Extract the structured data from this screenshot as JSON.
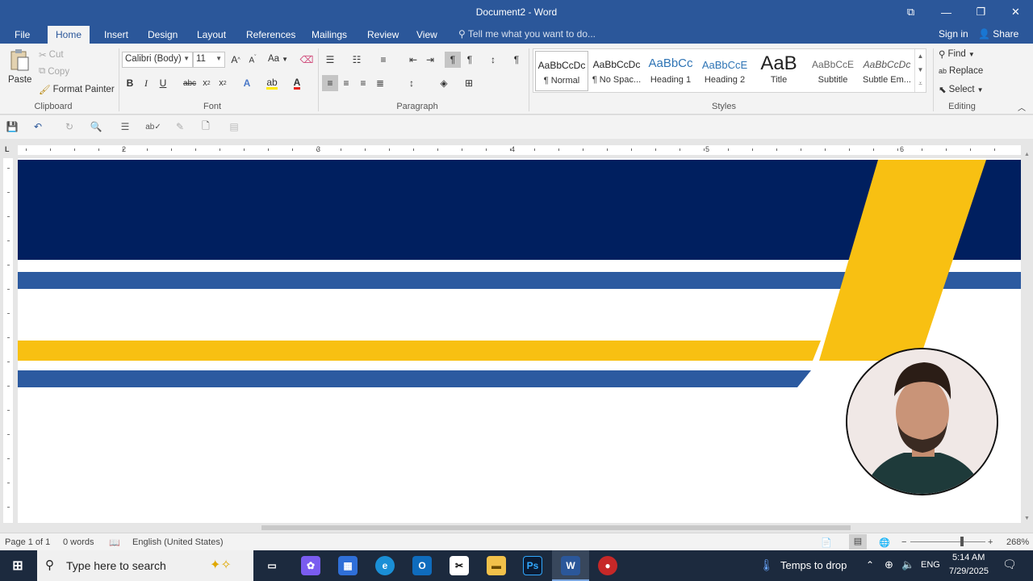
{
  "window": {
    "title": "Document2 - Word",
    "controls": [
      "⧉",
      "—",
      "❐",
      "✕"
    ]
  },
  "tabs": {
    "items": [
      "File",
      "Home",
      "Insert",
      "Design",
      "Layout",
      "References",
      "Mailings",
      "Review",
      "View"
    ],
    "active": "Home",
    "tellme": "Tell me what you want to do...",
    "signin": "Sign in",
    "share": "Share"
  },
  "ribbon": {
    "clipboard": {
      "label": "Clipboard",
      "paste": "Paste",
      "cut": "Cut",
      "copy": "Copy",
      "format_painter": "Format Painter"
    },
    "font": {
      "label": "Font",
      "name": "Calibri (Body)",
      "size": "11",
      "case_btn": "Aa"
    },
    "paragraph": {
      "label": "Paragraph"
    },
    "styles": {
      "label": "Styles",
      "items": [
        {
          "preview": "AaBbCcDc",
          "name": "¶ Normal"
        },
        {
          "preview": "AaBbCcDc",
          "name": "¶ No Spac..."
        },
        {
          "preview": "AaBbCc",
          "name": "Heading 1"
        },
        {
          "preview": "AaBbCcE",
          "name": "Heading 2"
        },
        {
          "preview": "AaB",
          "name": "Title"
        },
        {
          "preview": "AaBbCcE",
          "name": "Subtitle"
        },
        {
          "preview": "AaBbCcDc",
          "name": "Subtle Em..."
        }
      ]
    },
    "editing": {
      "label": "Editing",
      "find": "Find",
      "replace": "Replace",
      "select": "Select"
    }
  },
  "ruler": {
    "numbers": [
      "2",
      "3",
      "4",
      "5",
      "6"
    ]
  },
  "status": {
    "page": "Page 1 of 1",
    "words": "0 words",
    "language": "English (United States)",
    "zoom": "268%"
  },
  "taskbar": {
    "search_placeholder": "Type here to search",
    "weather": "Temps to drop",
    "lang": "ENG",
    "time": "5:14 AM",
    "date": "7/29/2025"
  },
  "colors": {
    "word_blue": "#2b579a",
    "navy": "#001f5f",
    "mid_blue": "#2c5aa0",
    "gold": "#f8c012"
  }
}
